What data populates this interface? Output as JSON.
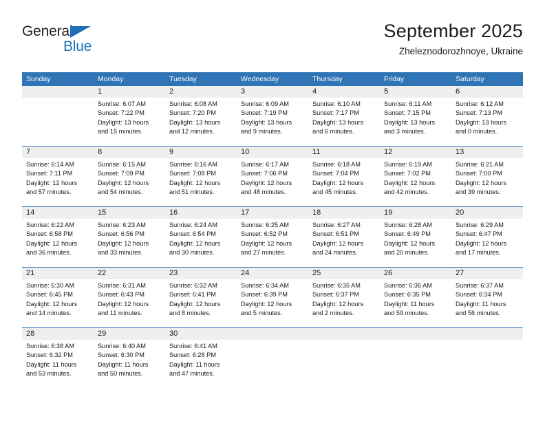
{
  "brand": {
    "line1": "General",
    "line2": "Blue",
    "triangle_color": "#1c71b9"
  },
  "header": {
    "title": "September 2025",
    "location": "Zheleznodorozhnoye, Ukraine"
  },
  "theme": {
    "header_blue": "#2f74b5",
    "day_band_gray": "#efefef",
    "text": "#1a1a1a"
  },
  "weekdays": [
    "Sunday",
    "Monday",
    "Tuesday",
    "Wednesday",
    "Thursday",
    "Friday",
    "Saturday"
  ],
  "weeks": [
    [
      {
        "day": "",
        "lines": []
      },
      {
        "day": "1",
        "lines": [
          "Sunrise: 6:07 AM",
          "Sunset: 7:22 PM",
          "Daylight: 13 hours",
          "and 15 minutes."
        ]
      },
      {
        "day": "2",
        "lines": [
          "Sunrise: 6:08 AM",
          "Sunset: 7:20 PM",
          "Daylight: 13 hours",
          "and 12 minutes."
        ]
      },
      {
        "day": "3",
        "lines": [
          "Sunrise: 6:09 AM",
          "Sunset: 7:19 PM",
          "Daylight: 13 hours",
          "and 9 minutes."
        ]
      },
      {
        "day": "4",
        "lines": [
          "Sunrise: 6:10 AM",
          "Sunset: 7:17 PM",
          "Daylight: 13 hours",
          "and 6 minutes."
        ]
      },
      {
        "day": "5",
        "lines": [
          "Sunrise: 6:11 AM",
          "Sunset: 7:15 PM",
          "Daylight: 13 hours",
          "and 3 minutes."
        ]
      },
      {
        "day": "6",
        "lines": [
          "Sunrise: 6:12 AM",
          "Sunset: 7:13 PM",
          "Daylight: 13 hours",
          "and 0 minutes."
        ]
      }
    ],
    [
      {
        "day": "7",
        "lines": [
          "Sunrise: 6:14 AM",
          "Sunset: 7:11 PM",
          "Daylight: 12 hours",
          "and 57 minutes."
        ]
      },
      {
        "day": "8",
        "lines": [
          "Sunrise: 6:15 AM",
          "Sunset: 7:09 PM",
          "Daylight: 12 hours",
          "and 54 minutes."
        ]
      },
      {
        "day": "9",
        "lines": [
          "Sunrise: 6:16 AM",
          "Sunset: 7:08 PM",
          "Daylight: 12 hours",
          "and 51 minutes."
        ]
      },
      {
        "day": "10",
        "lines": [
          "Sunrise: 6:17 AM",
          "Sunset: 7:06 PM",
          "Daylight: 12 hours",
          "and 48 minutes."
        ]
      },
      {
        "day": "11",
        "lines": [
          "Sunrise: 6:18 AM",
          "Sunset: 7:04 PM",
          "Daylight: 12 hours",
          "and 45 minutes."
        ]
      },
      {
        "day": "12",
        "lines": [
          "Sunrise: 6:19 AM",
          "Sunset: 7:02 PM",
          "Daylight: 12 hours",
          "and 42 minutes."
        ]
      },
      {
        "day": "13",
        "lines": [
          "Sunrise: 6:21 AM",
          "Sunset: 7:00 PM",
          "Daylight: 12 hours",
          "and 39 minutes."
        ]
      }
    ],
    [
      {
        "day": "14",
        "lines": [
          "Sunrise: 6:22 AM",
          "Sunset: 6:58 PM",
          "Daylight: 12 hours",
          "and 36 minutes."
        ]
      },
      {
        "day": "15",
        "lines": [
          "Sunrise: 6:23 AM",
          "Sunset: 6:56 PM",
          "Daylight: 12 hours",
          "and 33 minutes."
        ]
      },
      {
        "day": "16",
        "lines": [
          "Sunrise: 6:24 AM",
          "Sunset: 6:54 PM",
          "Daylight: 12 hours",
          "and 30 minutes."
        ]
      },
      {
        "day": "17",
        "lines": [
          "Sunrise: 6:25 AM",
          "Sunset: 6:52 PM",
          "Daylight: 12 hours",
          "and 27 minutes."
        ]
      },
      {
        "day": "18",
        "lines": [
          "Sunrise: 6:27 AM",
          "Sunset: 6:51 PM",
          "Daylight: 12 hours",
          "and 24 minutes."
        ]
      },
      {
        "day": "19",
        "lines": [
          "Sunrise: 6:28 AM",
          "Sunset: 6:49 PM",
          "Daylight: 12 hours",
          "and 20 minutes."
        ]
      },
      {
        "day": "20",
        "lines": [
          "Sunrise: 6:29 AM",
          "Sunset: 6:47 PM",
          "Daylight: 12 hours",
          "and 17 minutes."
        ]
      }
    ],
    [
      {
        "day": "21",
        "lines": [
          "Sunrise: 6:30 AM",
          "Sunset: 6:45 PM",
          "Daylight: 12 hours",
          "and 14 minutes."
        ]
      },
      {
        "day": "22",
        "lines": [
          "Sunrise: 6:31 AM",
          "Sunset: 6:43 PM",
          "Daylight: 12 hours",
          "and 11 minutes."
        ]
      },
      {
        "day": "23",
        "lines": [
          "Sunrise: 6:32 AM",
          "Sunset: 6:41 PM",
          "Daylight: 12 hours",
          "and 8 minutes."
        ]
      },
      {
        "day": "24",
        "lines": [
          "Sunrise: 6:34 AM",
          "Sunset: 6:39 PM",
          "Daylight: 12 hours",
          "and 5 minutes."
        ]
      },
      {
        "day": "25",
        "lines": [
          "Sunrise: 6:35 AM",
          "Sunset: 6:37 PM",
          "Daylight: 12 hours",
          "and 2 minutes."
        ]
      },
      {
        "day": "26",
        "lines": [
          "Sunrise: 6:36 AM",
          "Sunset: 6:35 PM",
          "Daylight: 11 hours",
          "and 59 minutes."
        ]
      },
      {
        "day": "27",
        "lines": [
          "Sunrise: 6:37 AM",
          "Sunset: 6:34 PM",
          "Daylight: 11 hours",
          "and 56 minutes."
        ]
      }
    ],
    [
      {
        "day": "28",
        "lines": [
          "Sunrise: 6:38 AM",
          "Sunset: 6:32 PM",
          "Daylight: 11 hours",
          "and 53 minutes."
        ]
      },
      {
        "day": "29",
        "lines": [
          "Sunrise: 6:40 AM",
          "Sunset: 6:30 PM",
          "Daylight: 11 hours",
          "and 50 minutes."
        ]
      },
      {
        "day": "30",
        "lines": [
          "Sunrise: 6:41 AM",
          "Sunset: 6:28 PM",
          "Daylight: 11 hours",
          "and 47 minutes."
        ]
      },
      {
        "day": "",
        "lines": []
      },
      {
        "day": "",
        "lines": []
      },
      {
        "day": "",
        "lines": []
      },
      {
        "day": "",
        "lines": []
      }
    ]
  ]
}
